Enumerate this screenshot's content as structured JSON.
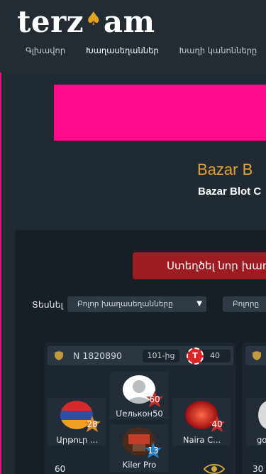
{
  "header": {
    "logo_left": "terz",
    "logo_right": "am",
    "nav": [
      "Գլխավոր",
      "Խաղասեղաններ",
      "Խաղի կանոնները"
    ]
  },
  "hero": {
    "title": "Bazar B",
    "subtitle": "Bazar Blot C"
  },
  "lobby": {
    "create_button": "Ստեղծել նոր խաղ",
    "filter_label": "Տեսնել",
    "filter_tables": "Բոլոր խաղասեղանները",
    "filter_all": "Բոլորը"
  },
  "table": {
    "id": "N 1820890",
    "points": "101-ից",
    "chip_letter": "T",
    "bet": "40",
    "seats": [
      {
        "name": "Մелькон50",
        "level": "60",
        "level_color": "#c9302c"
      },
      {
        "name": "Արթուր ...",
        "level": "28",
        "level_color": "#e08a2a"
      },
      {
        "name": "Naira C...",
        "level": "40",
        "level_color": "#c9302c"
      },
      {
        "name": "Kiler Pro",
        "level": "13",
        "level_color": "#2b7fc1"
      }
    ],
    "score": "60"
  },
  "table2": {
    "seat_name": "go",
    "score": "30"
  },
  "colors": {
    "accent_orange": "#e5a034",
    "banner_pink": "#ff0a8c",
    "button_red": "#9c1c22"
  }
}
